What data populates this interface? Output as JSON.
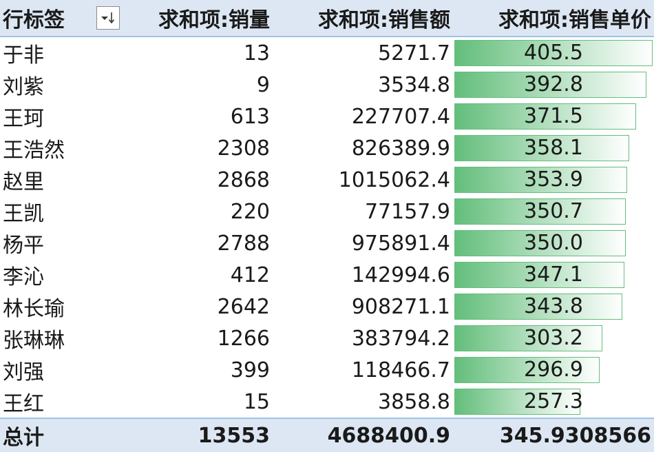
{
  "colors": {
    "header_bg": "#dde7f3",
    "header_border": "#9dc3e6",
    "databar": "#63be7b"
  },
  "header": {
    "row_label": "行标签",
    "filter_icon": "sort-filter-icon",
    "filter_glyph": "▾↓",
    "col_qty": "求和项:销量",
    "col_sales": "求和项:销售额",
    "col_price": "求和项:销售单价"
  },
  "rows": [
    {
      "name": "于非",
      "qty": "13",
      "sales": "5271.7",
      "price": "405.5",
      "bar_fraction": 1.0
    },
    {
      "name": "刘紫",
      "qty": "9",
      "sales": "3534.8",
      "price": "392.8",
      "bar_fraction": 0.969
    },
    {
      "name": "王珂",
      "qty": "613",
      "sales": "227707.4",
      "price": "371.5",
      "bar_fraction": 0.916
    },
    {
      "name": "王浩然",
      "qty": "2308",
      "sales": "826389.9",
      "price": "358.1",
      "bar_fraction": 0.883
    },
    {
      "name": "赵里",
      "qty": "2868",
      "sales": "1015062.4",
      "price": "353.9",
      "bar_fraction": 0.873
    },
    {
      "name": "王凯",
      "qty": "220",
      "sales": "77157.9",
      "price": "350.7",
      "bar_fraction": 0.865
    },
    {
      "name": "杨平",
      "qty": "2788",
      "sales": "975891.4",
      "price": "350.0",
      "bar_fraction": 0.863
    },
    {
      "name": "李沁",
      "qty": "412",
      "sales": "142994.6",
      "price": "347.1",
      "bar_fraction": 0.856
    },
    {
      "name": "林长瑜",
      "qty": "2642",
      "sales": "908271.1",
      "price": "343.8",
      "bar_fraction": 0.848
    },
    {
      "name": "张琳琳",
      "qty": "1266",
      "sales": "383794.2",
      "price": "303.2",
      "bar_fraction": 0.748
    },
    {
      "name": "刘强",
      "qty": "399",
      "sales": "118466.7",
      "price": "296.9",
      "bar_fraction": 0.732
    },
    {
      "name": "王红",
      "qty": "15",
      "sales": "3858.8",
      "price": "257.3",
      "bar_fraction": 0.635
    }
  ],
  "total": {
    "label": "总计",
    "qty": "13553",
    "sales": "4688400.9",
    "price": "345.9308566"
  }
}
